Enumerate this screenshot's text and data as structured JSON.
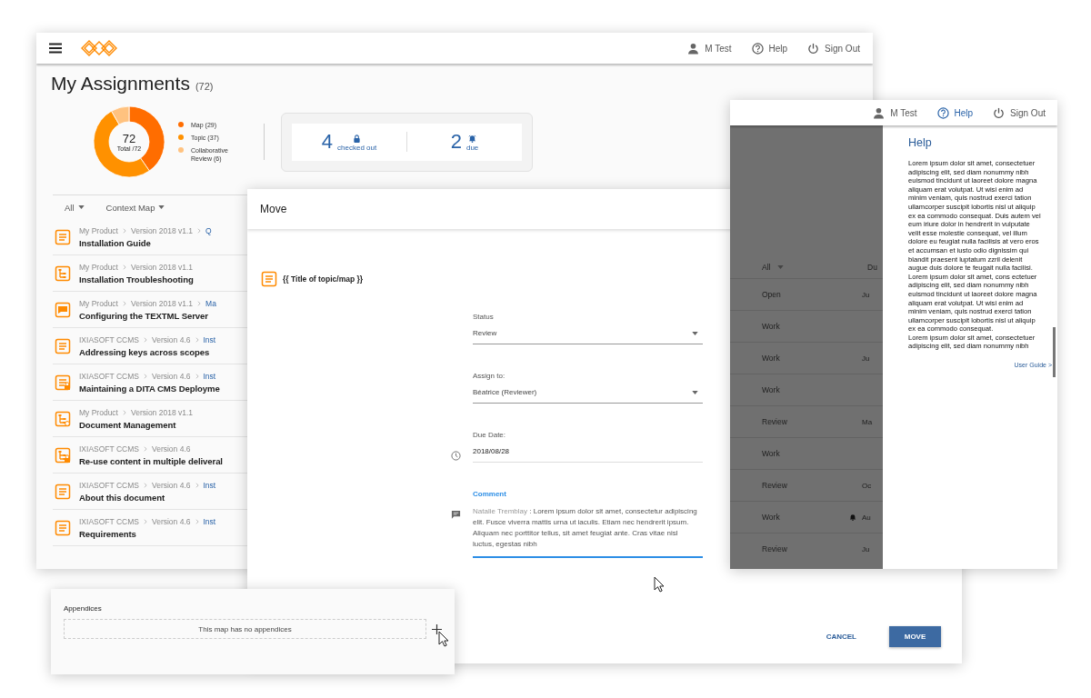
{
  "main_window": {
    "header": [
      {
        "kind": "user",
        "label": "M Test",
        "selected": false
      },
      {
        "kind": "help",
        "label": "Help",
        "selected": false
      },
      {
        "kind": "sign_out",
        "label": "Sign Out",
        "selected": false
      }
    ],
    "title": "My Assignments",
    "count": "(72)",
    "summary": {
      "center_value": "72",
      "center_label": "Total /72",
      "chart_data": {
        "type": "donut",
        "categories": [
          "Map",
          "Topic",
          "Collaborative Review"
        ],
        "values": [
          40.3,
          51.4,
          8.3
        ]
      },
      "legend": [
        {
          "count": "(29)",
          "color": "#ff6d00"
        },
        {
          "count": "(37)",
          "color": "#ff9100"
        },
        {
          "count": "(6)",
          "color": "#ffc27f"
        }
      ]
    },
    "stats": [
      {
        "kind": "locked",
        "value": "4",
        "label": "checked out"
      },
      {
        "kind": "due",
        "value": "2",
        "label": "due"
      }
    ],
    "filters": [
      "All",
      "Context Map"
    ],
    "rows": [
      {
        "kind": "topic",
        "path": [
          "My Product",
          "Version 2018 v1.1"
        ],
        "link": "Q",
        "title": "Installation Guide"
      },
      {
        "kind": "map",
        "path": [
          "My Product",
          "Version 2018 v1.1"
        ],
        "title": "Installation Troubleshooting"
      },
      {
        "kind": "comment",
        "path": [
          "My Product",
          "Version 2018 v1.1"
        ],
        "link": "Ma",
        "title": "Configuring the TEXTML Server"
      },
      {
        "kind": "topic",
        "path": [
          "IXIASOFT CCMS",
          "Version 4.6"
        ],
        "link": "Inst",
        "title": "Addressing keys across scopes"
      },
      {
        "kind": "topic_locked",
        "path": [
          "IXIASOFT CCMS",
          "Version 4.6"
        ],
        "link": "Inst",
        "title": "Maintaining a DITA CMS Deployme"
      },
      {
        "kind": "map_linked",
        "path": [
          "My Product",
          "Version 2018 v1.1"
        ],
        "title": "Document Management"
      },
      {
        "kind": "map_locked",
        "path": [
          "IXIASOFT CCMS",
          "Version 4.6"
        ],
        "title": "Re-use content in multiple deliveral"
      },
      {
        "kind": "topic",
        "path": [
          "IXIASOFT CCMS",
          "Version 4.6"
        ],
        "link": "Inst",
        "title": "About this document"
      },
      {
        "kind": "topic",
        "path": [
          "IXIASOFT CCMS",
          "Version 4.6"
        ],
        "link": "Inst",
        "title": "Requirements"
      }
    ]
  },
  "move_dialog": {
    "title": "Move",
    "item_title": "{{ Title of topic/map }}",
    "fields": [
      {
        "kind": "select",
        "label": "Status",
        "value": "Review",
        "focused": false
      },
      {
        "kind": "select",
        "label": "Assign to:",
        "value": "Béatrice (Reviewer)",
        "focused": false
      },
      {
        "kind": "date",
        "label": "Due Date:",
        "value": "2018/08/28",
        "focused": false
      },
      {
        "kind": "comment",
        "label": "Comment",
        "author": "Natalie Tremblay",
        "value": " : Lorem ipsum dolor sit amet, consectetur adipiscing elit. Fusce viverra mattis urna ut iaculis. Etiam nec hendrerit ipsum. Aliquam nec porttitor tellus, sit amet feugiat ante. Cras vitae nisl luctus, egestas nibh",
        "focused": true
      }
    ],
    "buttons": [
      {
        "kind": "flat",
        "label": "CANCEL"
      },
      {
        "kind": "raised",
        "label": "MOVE"
      }
    ]
  },
  "help_window": {
    "header": [
      {
        "kind": "user",
        "label": "M Test",
        "selected": false
      },
      {
        "kind": "help",
        "label": "Help",
        "selected": true
      },
      {
        "kind": "sign_out",
        "label": "Sign Out",
        "selected": false
      }
    ],
    "list": {
      "filter": "All",
      "column_2": "Du",
      "rows": [
        {
          "status": "Open",
          "column_2": "Ju",
          "alert": false
        },
        {
          "status": "Work",
          "alert": false
        },
        {
          "status": "Work",
          "column_2": "Ju",
          "alert": false
        },
        {
          "status": "Work",
          "alert": false
        },
        {
          "status": "Review",
          "column_2": "Ma",
          "alert": false
        },
        {
          "status": "Work",
          "alert": false
        },
        {
          "status": "Review",
          "column_2": "Oc",
          "alert": false
        },
        {
          "status": "Work",
          "column_2": "Au",
          "alert": true
        },
        {
          "status": "Review",
          "column_2": "Ju",
          "alert": false
        }
      ]
    },
    "help_panel": {
      "title": "Help",
      "paragraphs": [
        "Lorem ipsum dolor sit amet, consectetuer adipiscing elit, sed diam nonummy nibh euismod tincidunt ut laoreet dolore magna aliquam erat volutpat. Ut wisi enim ad minim veniam, quis nostrud exerci tation ullamcorper suscipit lobortis nisl ut aliquip ex ea commodo consequat. Duis autem vel eum iriure dolor in hendrerit in vulputate velit esse molestie consequat, vel illum dolore eu feugiat nulla facilisis at vero eros et accumsan et iusto odio dignissim qui blandit praesent luptatum zzril delenit augue duis dolore te feugait nulla facilisi.",
        "Lorem ipsum dolor sit amet, cons ectetuer adipiscing elit, sed diam nonummy nibh euismod tincidunt ut laoreet dolore magna aliquam erat volutpat. Ut wisi enim ad minim veniam, quis nostrud exerci tation ullamcorper suscipit lobortis nisl ut aliquip ex ea commodo consequat.",
        "Lorem ipsum dolor sit amet, consectetuer adipiscing elit, sed diam nonummy nibh"
      ],
      "link": "User Guide >"
    }
  },
  "appendices": {
    "title": "Appendices",
    "empty_text": "This map has no appendices"
  }
}
